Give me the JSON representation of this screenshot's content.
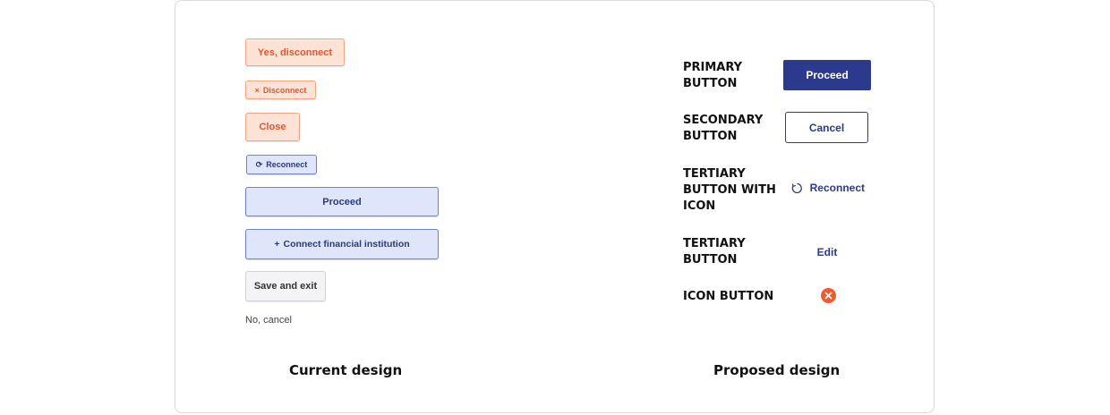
{
  "current": {
    "caption": "Current design",
    "yes_disconnect": "Yes, disconnect",
    "disconnect_icon": "×",
    "disconnect": "Disconnect",
    "close": "Close",
    "reconnect_icon": "⟳",
    "reconnect": "Reconnect",
    "proceed": "Proceed",
    "connect_icon": "+",
    "connect": "Connect financial institution",
    "save_exit": "Save and exit",
    "no_cancel": "No, cancel"
  },
  "proposed": {
    "caption": "Proposed design",
    "primary_label_1": "PRIMARY",
    "primary_label_2": "BUTTON",
    "primary_button": "Proceed",
    "secondary_label_1": "SECONDARY",
    "secondary_label_2": "BUTTON",
    "secondary_button": "Cancel",
    "tertiary_icon_label_1": "TERTIARY",
    "tertiary_icon_label_2": "BUTTON WITH",
    "tertiary_icon_label_3": "ICON",
    "tertiary_icon_button": "Reconnect",
    "tertiary_label_1": "TERTIARY",
    "tertiary_label_2": "BUTTON",
    "tertiary_button": "Edit",
    "icon_button_label": "ICON BUTTON"
  },
  "colors": {
    "orange_bg": "#fde3d6",
    "orange_text": "#e4572e",
    "blue_bg": "#dfe6fb",
    "navy": "#2b3a8c",
    "icon_button": "#ef5a2e"
  },
  "icons": {
    "close": "close-icon",
    "reconnect": "refresh-icon",
    "add": "plus-icon",
    "clear": "clear-circle-icon"
  }
}
